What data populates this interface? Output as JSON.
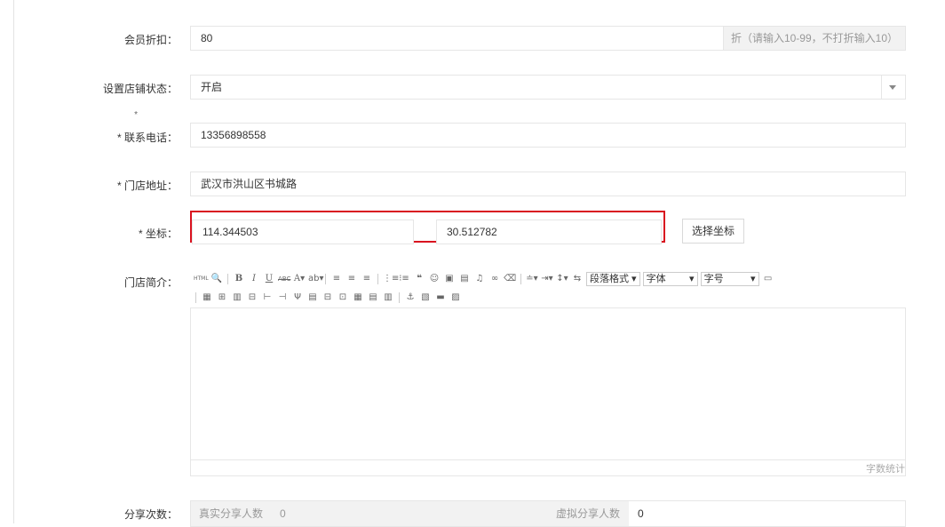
{
  "fields": {
    "discount": {
      "label": "会员折扣：",
      "value": "80",
      "addon": "折（请输入10-99，不打折输入10）"
    },
    "store_status": {
      "label": "设置店铺状态：",
      "value": "开启"
    },
    "phone": {
      "label": "* 联系电话：",
      "value": "13356898558",
      "stray_mark": "*"
    },
    "address": {
      "label": "* 门店地址：",
      "value": "武汉市洪山区书城路"
    },
    "coords": {
      "label": "* 坐标：",
      "longitude": "114.344503",
      "latitude": "30.512782",
      "pick_button": "选择坐标",
      "highlight_color": "#d9121f"
    },
    "intro": {
      "label": "门店简介：",
      "toolbar": {
        "html": "HTML",
        "paragraph_format": "段落格式",
        "font_family": "字体",
        "font_size": "字号"
      },
      "word_count": "字数统计"
    },
    "share": {
      "label": "分享次数：",
      "real_label": "真实分享人数",
      "real_value": "0",
      "virtual_label": "虚拟分享人数",
      "virtual_value": "0"
    }
  }
}
